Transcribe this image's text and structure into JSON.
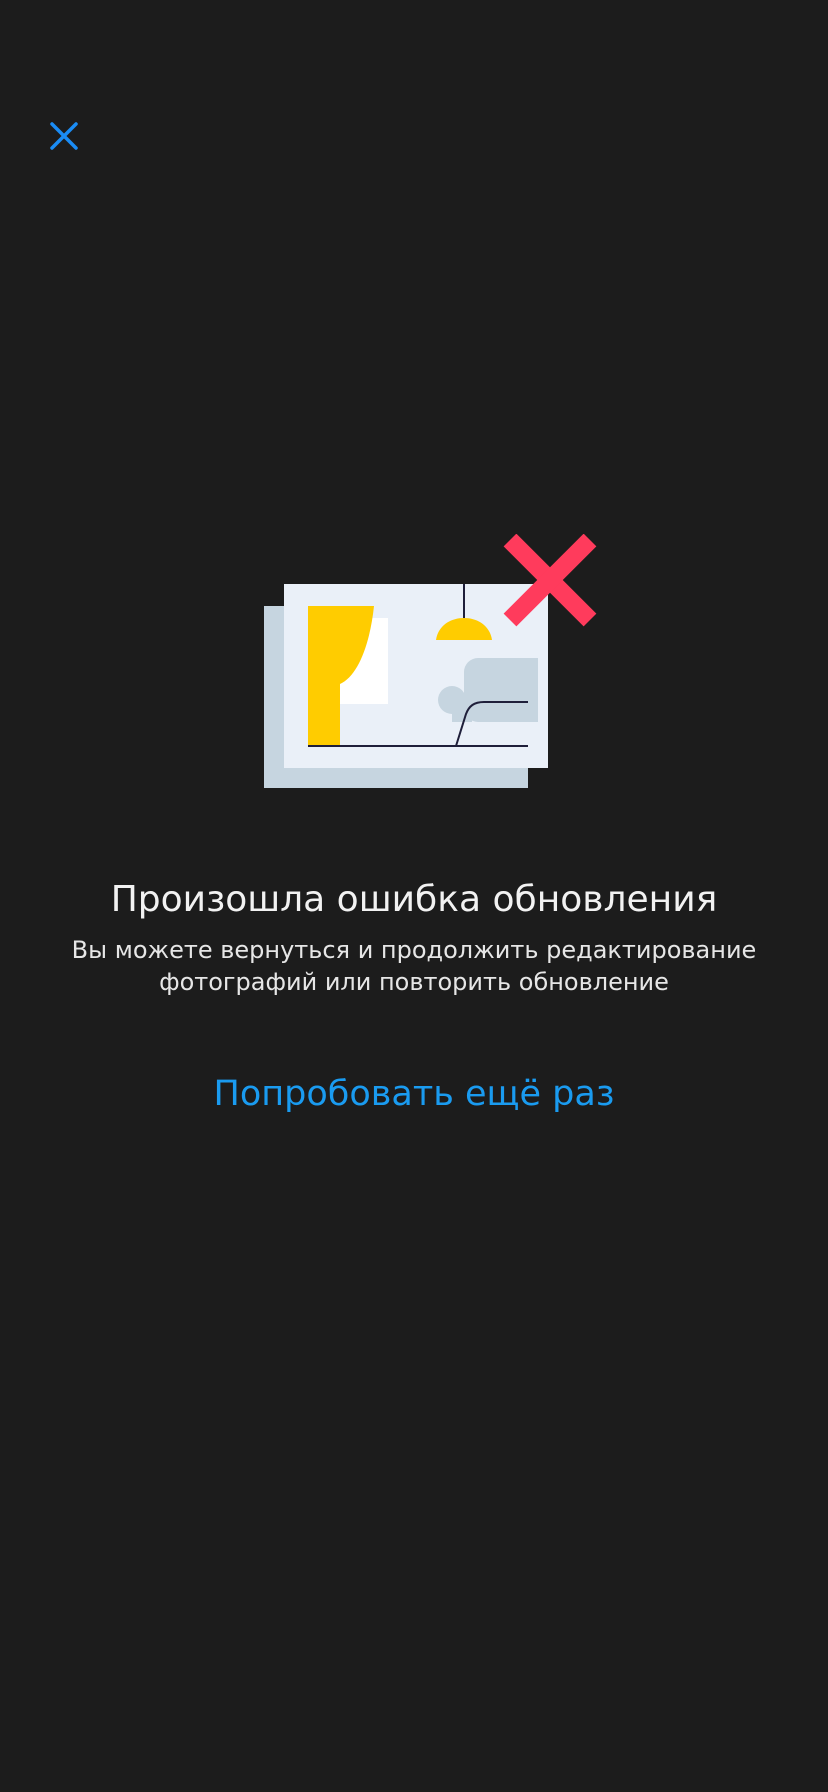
{
  "error": {
    "title": "Произошла ошибка обновления",
    "message": "Вы можете вернуться и продолжить редактирование фотографий или повторить обновление"
  },
  "actions": {
    "retry_label": "Попробовать ещё раз"
  },
  "colors": {
    "background": "#1c1c1c",
    "accent": "#1a9bf0",
    "error_mark": "#ff3b5c",
    "curtain": "#ffcc00"
  },
  "icons": {
    "close": "close-icon",
    "illustration": "photo-upload-error-illustration"
  }
}
